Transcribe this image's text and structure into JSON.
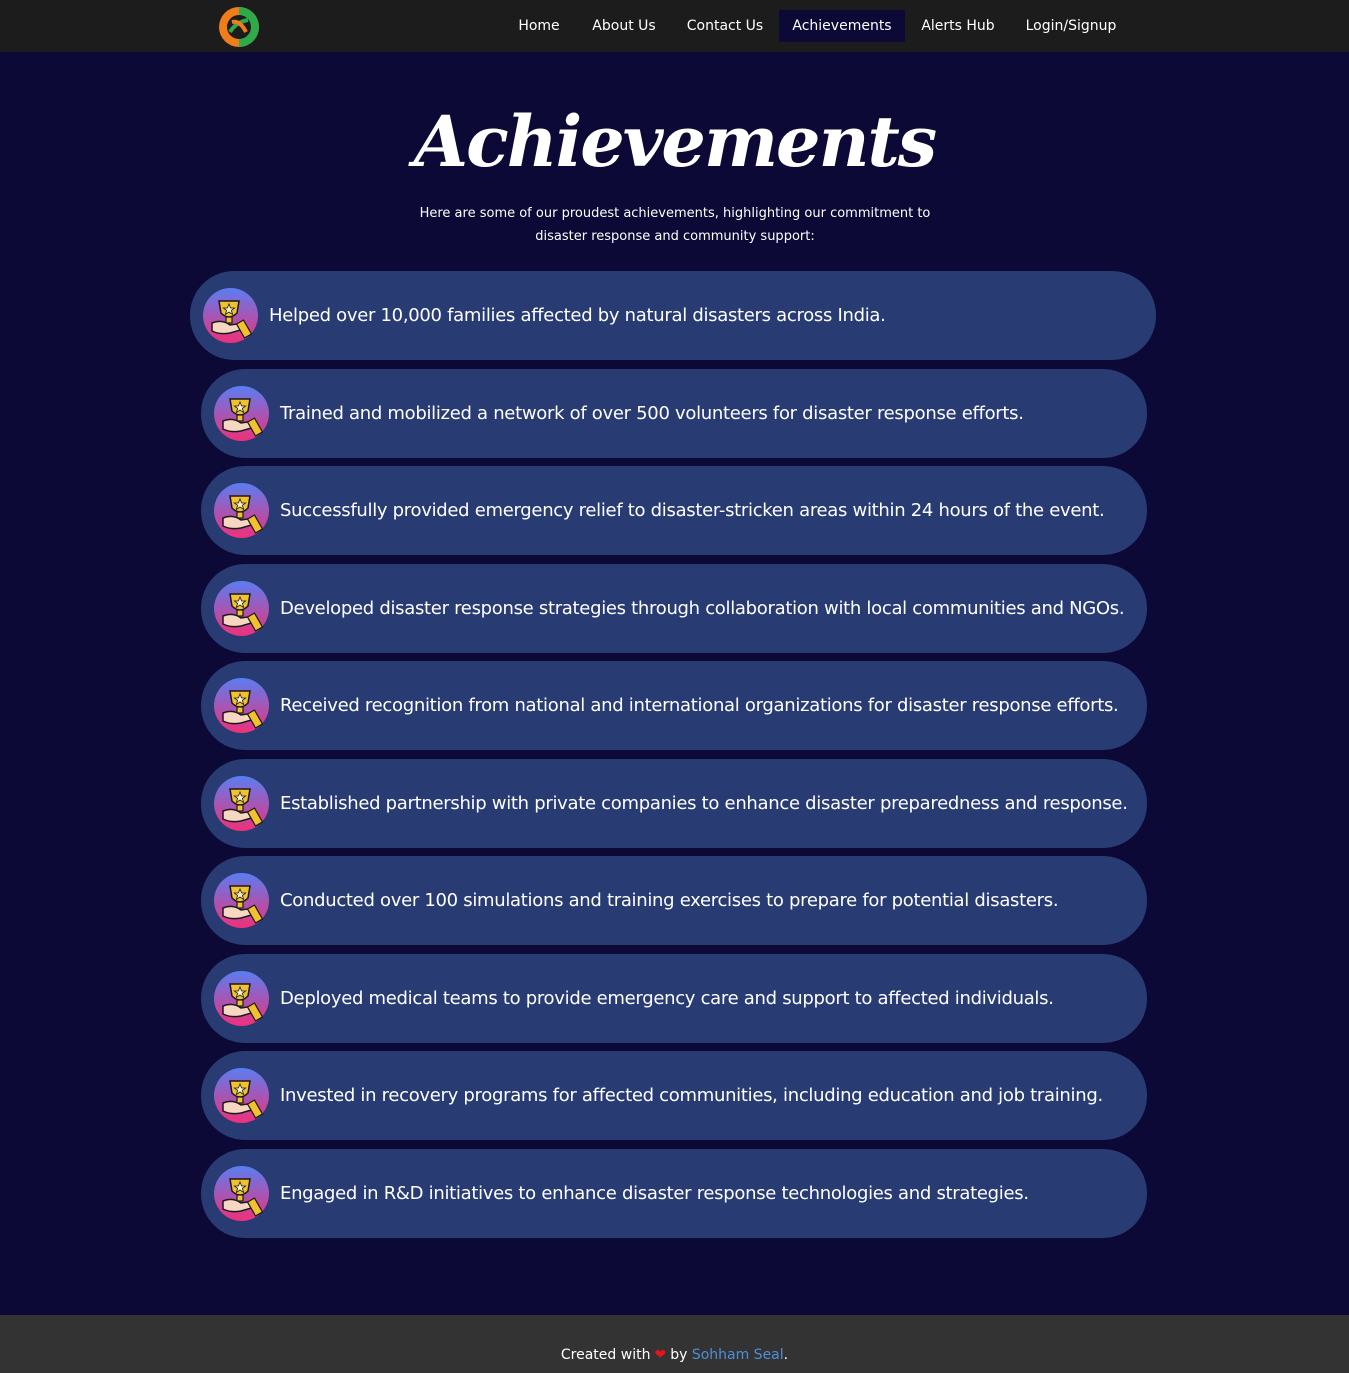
{
  "nav": {
    "logo_name": "helping-hands-logo-icon",
    "links": [
      {
        "label": "Home"
      },
      {
        "label": "About Us"
      },
      {
        "label": "Contact Us"
      },
      {
        "label": "Achievements",
        "active": true
      },
      {
        "label": "Alerts Hub"
      },
      {
        "label": "Login/Signup"
      }
    ]
  },
  "main": {
    "title": "Achievements",
    "subtitle": "Here are some of our proudest achievements, highlighting our commitment to disaster response and community support:",
    "achievements": [
      {
        "text": "Helped over 10,000 families affected by natural disasters across India."
      },
      {
        "text": "Trained and mobilized a network of over 500 volunteers for disaster response efforts."
      },
      {
        "text": "Successfully provided emergency relief to disaster-stricken areas within 24 hours of the event."
      },
      {
        "text": "Developed disaster response strategies through collaboration with local communities and NGOs."
      },
      {
        "text": "Received recognition  from national and international organizations for disaster response efforts."
      },
      {
        "text": "Established partnership with private companies to enhance disaster preparedness and response."
      },
      {
        "text": "Conducted over 100 simulations and training exercises to prepare for potential disasters."
      },
      {
        "text": "Deployed medical teams to provide emergency care and support to affected individuals."
      },
      {
        "text": "Invested in recovery programs for affected communities, including education and job training."
      },
      {
        "text": "Engaged in R&D initiatives to enhance disaster response technologies and strategies."
      }
    ],
    "icon_name": "trophy-hand-icon"
  },
  "footer": {
    "prefix": "Created with",
    "heart": "❤",
    "by": "by",
    "author": "Sohham Seal",
    "suffix": "."
  },
  "colors": {
    "background": "#0d0936",
    "navbar": "#1c1c1c",
    "card": "#283b73",
    "footer": "#333333",
    "link": "#4f8fd6"
  }
}
